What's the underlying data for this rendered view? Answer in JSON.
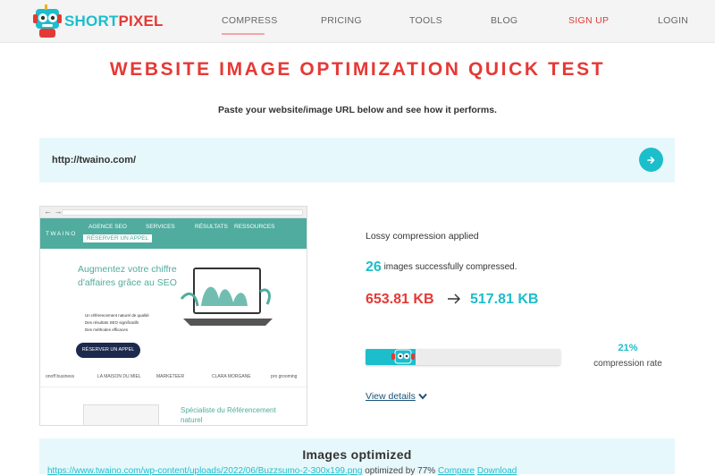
{
  "header": {
    "logo_short": "SHORT",
    "logo_pixel": "PIXEL",
    "nav": [
      "COMPRESS",
      "PRICING",
      "TOOLS",
      "BLOG",
      "SIGN UP",
      "LOGIN"
    ],
    "active_nav": "COMPRESS"
  },
  "main": {
    "title": "WEBSITE IMAGE OPTIMIZATION QUICK TEST",
    "subtitle": "Paste your website/image URL below and see how it performs."
  },
  "url_input": {
    "value": "http://twaino.com/",
    "go_icon": "arrow-right-icon"
  },
  "preview": {
    "brand": "TWAINO",
    "menu": [
      "AGENCE SEO",
      "SERVICES",
      "RÉSULTATS",
      "RESSOURCES"
    ],
    "cta_small": "RÉSERVER UN APPEL",
    "headline": "Augmentez votre chiffre d'affaires grâce au SEO",
    "bullets": [
      "Un référencement naturel de qualité",
      "Des résultats SEO significatifs",
      "Des méthodes efficaces"
    ],
    "cta": "RÉSERVER UN APPEL",
    "logos": [
      "onoff business",
      "LA MAISON DU MIEL",
      "MARKETEER",
      "CLARA MORGANE",
      "pro grooming"
    ],
    "specialist": "Spécialiste du Référencement naturel"
  },
  "results": {
    "compression_type": "Lossy compression applied",
    "count": "26",
    "count_label": "images successfully compressed.",
    "size_before": "653.81 KB",
    "size_after": "517.81 KB",
    "compression_rate": "21%",
    "compression_rate_label": "compression rate",
    "progress_fraction": 0.21,
    "view_details": "View details"
  },
  "optimized": {
    "title": "Images optimized",
    "first_url": "https://www.twaino.com/wp-content/uploads/2022/06/Buzzsumo-2-300x199.png",
    "first_text": "optimized by 77%",
    "compare": "Compare",
    "download": "Download"
  },
  "colors": {
    "brand_teal": "#1cbecb",
    "brand_red": "#e53935",
    "panel_bg": "#e7f8fc"
  }
}
